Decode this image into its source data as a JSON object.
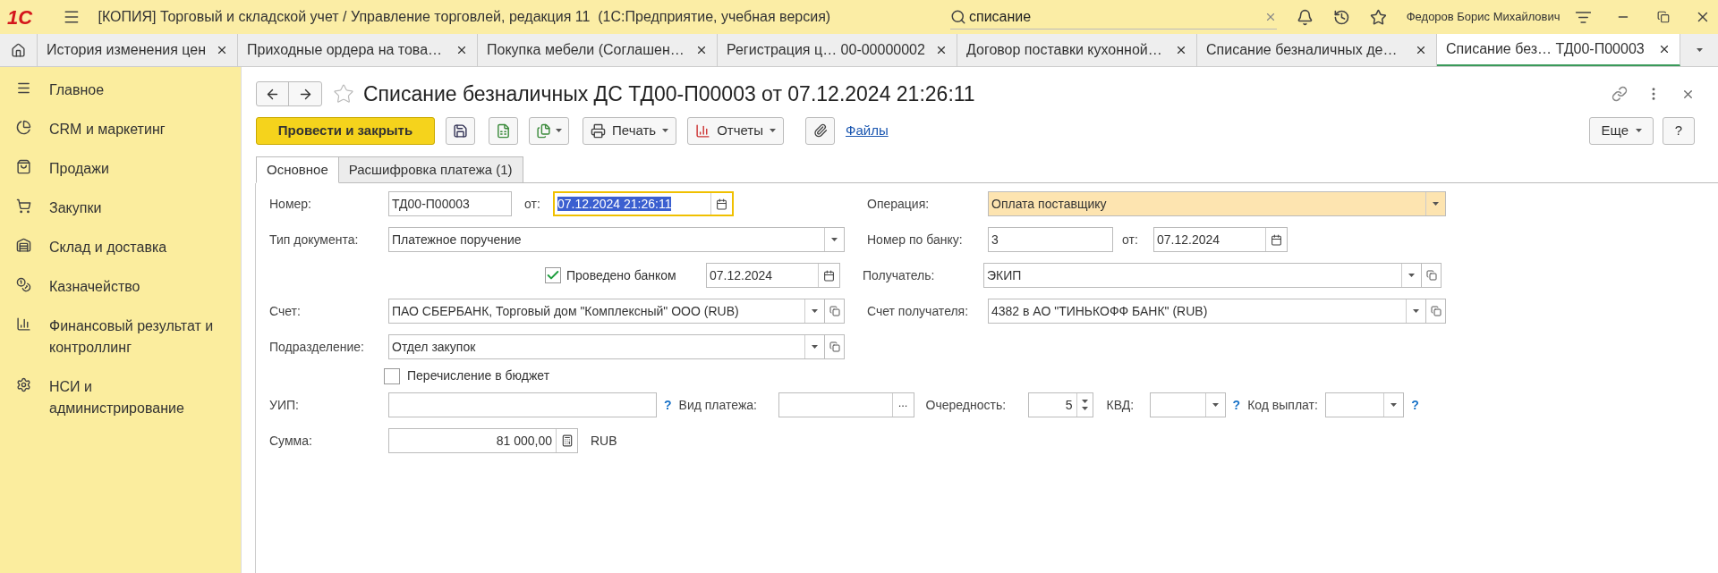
{
  "window": {
    "logo": "1С",
    "title": "[КОПИЯ] Торговый и складской учет / Управление торговлей, редакция 11  (1С:Предприятие, учебная версия)",
    "search": {
      "value": "списание"
    },
    "user": "Федоров Борис Михайлович"
  },
  "open_tabs": [
    {
      "label": "История изменения цен",
      "selected": false
    },
    {
      "label": "Приходные ордера на това…",
      "selected": false
    },
    {
      "label": "Покупка мебели (Соглашен…",
      "selected": false
    },
    {
      "label": "Регистрация ц… 00-00000002",
      "selected": false
    },
    {
      "label": "Договор поставки кухонной…",
      "selected": false
    },
    {
      "label": "Списание безналичных де…",
      "selected": false
    },
    {
      "label": "Списание без… ТД00-П00003",
      "selected": true
    }
  ],
  "sidebar": {
    "items": [
      {
        "label": "Главное"
      },
      {
        "label": "CRM и маркетинг"
      },
      {
        "label": "Продажи"
      },
      {
        "label": "Закупки"
      },
      {
        "label": "Склад и доставка"
      },
      {
        "label": "Казначейство"
      },
      {
        "label": "Финансовый результат и контроллинг"
      },
      {
        "label": "НСИ и администрирование"
      }
    ]
  },
  "form": {
    "title": "Списание безналичных ДС ТД00-П00003 от 07.12.2024 21:26:11",
    "toolbar": {
      "post_button": "Провести и закрыть",
      "print": "Печать",
      "reports": "Отчеты",
      "files_link": "Файлы",
      "more": "Еще",
      "help": "?"
    },
    "tabs": [
      {
        "label": "Основное",
        "selected": true
      },
      {
        "label": "Расшифровка платежа (1)",
        "selected": false
      }
    ],
    "fields": {
      "number": {
        "label": "Номер:",
        "value": "ТД00-П00003"
      },
      "date": {
        "label": "от:",
        "value": "07.12.2024 21:26:11",
        "focused": true
      },
      "operation": {
        "label": "Операция:",
        "value": "Оплата поставщику"
      },
      "doc_type": {
        "label": "Тип документа:",
        "value": "Платежное поручение"
      },
      "bank_number": {
        "label": "Номер по банку:",
        "value": "3"
      },
      "bank_date": {
        "label": "от:",
        "value": "07.12.2024"
      },
      "bank_posted": {
        "label": "Проведено банком",
        "checked": true,
        "date": "07.12.2024"
      },
      "recipient": {
        "label": "Получатель:",
        "value": "ЭКИП"
      },
      "account": {
        "label": "Счет:",
        "value": "ПАО СБЕРБАНК, Торговый дом \"Комплексный\" ООО (RUB)"
      },
      "recipient_account": {
        "label": "Счет получателя:",
        "value": "4382 в АО \"ТИНЬКОФФ БАНК\" (RUB)"
      },
      "department": {
        "label": "Подразделение:",
        "value": "Отдел закупок"
      },
      "budget_transfer": {
        "label": "Перечисление в бюджет",
        "checked": false
      },
      "uip": {
        "label": "УИП:",
        "help": "?"
      },
      "payment_kind": {
        "label": "Вид платежа:",
        "button": "..."
      },
      "priority": {
        "label": "Очередность:",
        "value": "5"
      },
      "kvd": {
        "label": "КВД:",
        "help": "?"
      },
      "payout_code": {
        "label": "Код выплат:",
        "help": "?"
      },
      "amount": {
        "label": "Сумма:",
        "value": "81 000,00",
        "currency": "RUB"
      }
    }
  }
}
